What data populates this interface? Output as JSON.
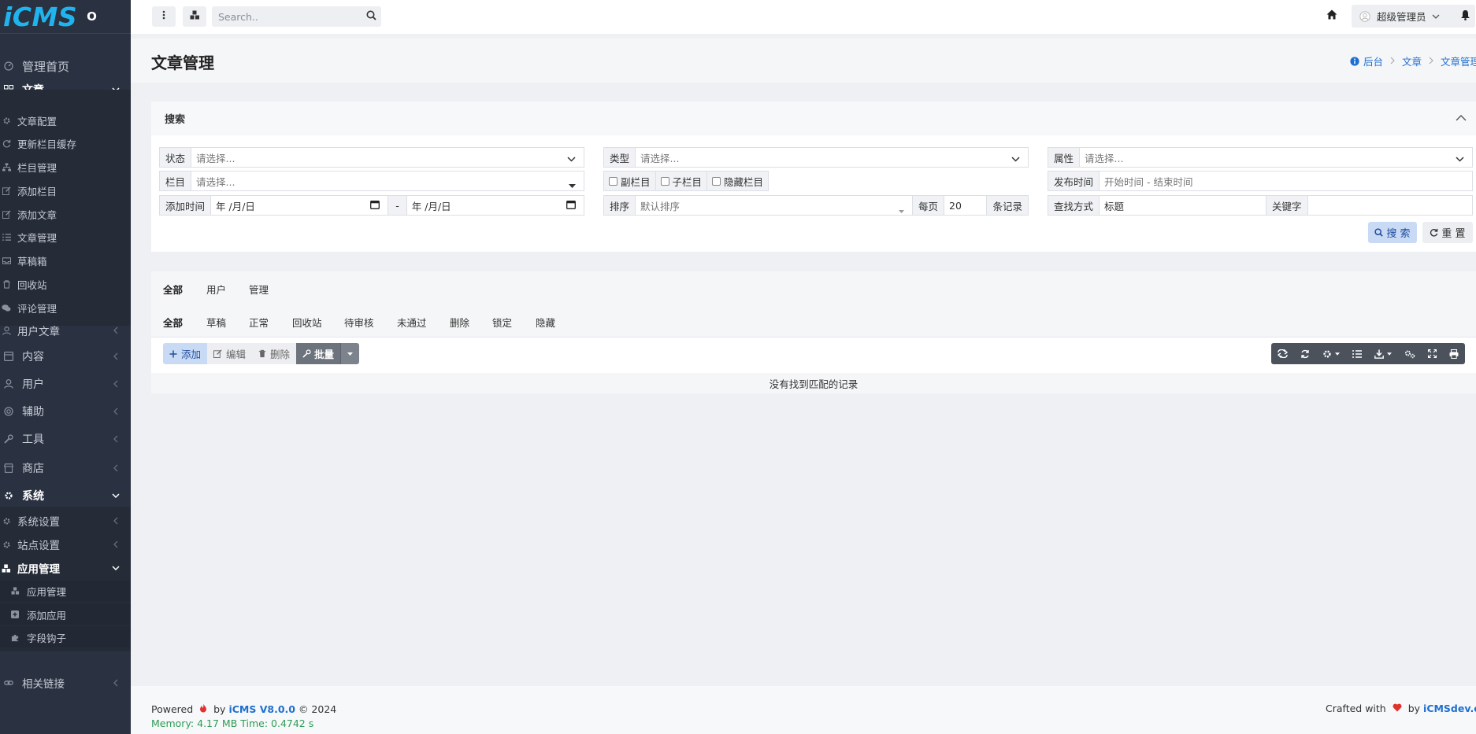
{
  "brand": {
    "logo": "iCMS",
    "mark": "O"
  },
  "sidebar": {
    "dashboard": "管理首页",
    "article_group": "文章",
    "article_items": [
      "文章配置",
      "更新栏目缓存",
      "栏目管理",
      "添加栏目",
      "添加文章",
      "文章管理",
      "草稿箱",
      "回收站",
      "评论管理",
      "用户文章"
    ],
    "content": "内容",
    "users": "用户",
    "assist": "辅助",
    "tools": "工具",
    "store": "商店",
    "system_group": "系统",
    "system_items": [
      "系统设置",
      "站点设置"
    ],
    "app_group": "应用管理",
    "app_items": [
      "应用管理",
      "添加应用",
      "字段钩子"
    ],
    "links": "相关链接"
  },
  "header": {
    "search_placeholder": "Search..",
    "user_name": "超级管理员"
  },
  "page": {
    "title": "文章管理",
    "breadcrumb": [
      "后台",
      "文章",
      "文章管理"
    ]
  },
  "search_panel": {
    "title": "搜索",
    "status_label": "状态",
    "status_placeholder": "请选择...",
    "type_label": "类型",
    "type_placeholder": "请选择...",
    "attr_label": "属性",
    "attr_placeholder": "请选择...",
    "column_label": "栏目",
    "column_placeholder": "请选择...",
    "checks": [
      "副栏目",
      "子栏目",
      "隐藏栏目"
    ],
    "publish_label": "发布时间",
    "publish_placeholder": "开始时间 - 结束时间",
    "addtime_label": "添加时间",
    "date_from": "年 /月/日",
    "date_sep": "-",
    "date_to": "年 /月/日",
    "sort_label": "排序",
    "sort_value": "默认排序",
    "per_page_label": "每页",
    "per_page_value": "20",
    "records_label": "条记录",
    "find_label": "查找方式",
    "find_value": "标题",
    "keyword_label": "关键字",
    "keyword_value": "",
    "search_button": "搜 索",
    "reset_button": "重 置"
  },
  "tabs_top": [
    "全部",
    "用户",
    "管理"
  ],
  "tabs_status": [
    "全部",
    "草稿",
    "正常",
    "回收站",
    "待审核",
    "未通过",
    "删除",
    "锁定",
    "隐藏"
  ],
  "toolbar": {
    "add": "添加",
    "edit": "编辑",
    "delete": "删除",
    "batch": "批量"
  },
  "table": {
    "empty_text": "没有找到匹配的记录"
  },
  "footer": {
    "powered": "Powered",
    "by": "by",
    "version": "iCMS V8.0.0",
    "copyright": "© 2024",
    "memory": "Memory: 4.17 MB Time: 0.4742 s",
    "crafted": "Crafted with",
    "by2": "by",
    "site": "iCMSdev.com"
  },
  "colors": {
    "sidebar_bg": "#2a3140",
    "logo": "#20b4ef",
    "link": "#1f6fd0",
    "batch_bg": "#6c737c",
    "table_toolbar_bg": "#4b525c"
  }
}
